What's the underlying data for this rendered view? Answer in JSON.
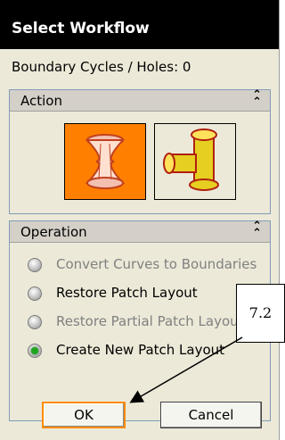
{
  "dialog": {
    "title": "Select Workflow",
    "info": "Boundary Cycles / Holes: 0"
  },
  "action": {
    "label": "Action",
    "tiles": [
      {
        "name": "hourglass-patch",
        "selected": true
      },
      {
        "name": "pipe-tee-part",
        "selected": false
      }
    ]
  },
  "operation": {
    "label": "Operation",
    "options": [
      {
        "label": "Convert Curves to Boundaries",
        "enabled": false,
        "checked": false
      },
      {
        "label": "Restore Patch Layout",
        "enabled": true,
        "checked": false
      },
      {
        "label": "Restore Partial Patch Layout",
        "enabled": false,
        "checked": false
      },
      {
        "label": "Create New Patch Layout",
        "enabled": true,
        "checked": true
      }
    ]
  },
  "buttons": {
    "ok": "OK",
    "cancel": "Cancel"
  },
  "callout": {
    "label": "7.2"
  },
  "colors": {
    "selected_tile": "#ff7f00",
    "radio_checked": "#1fa61f",
    "titlebar": "#000000"
  }
}
